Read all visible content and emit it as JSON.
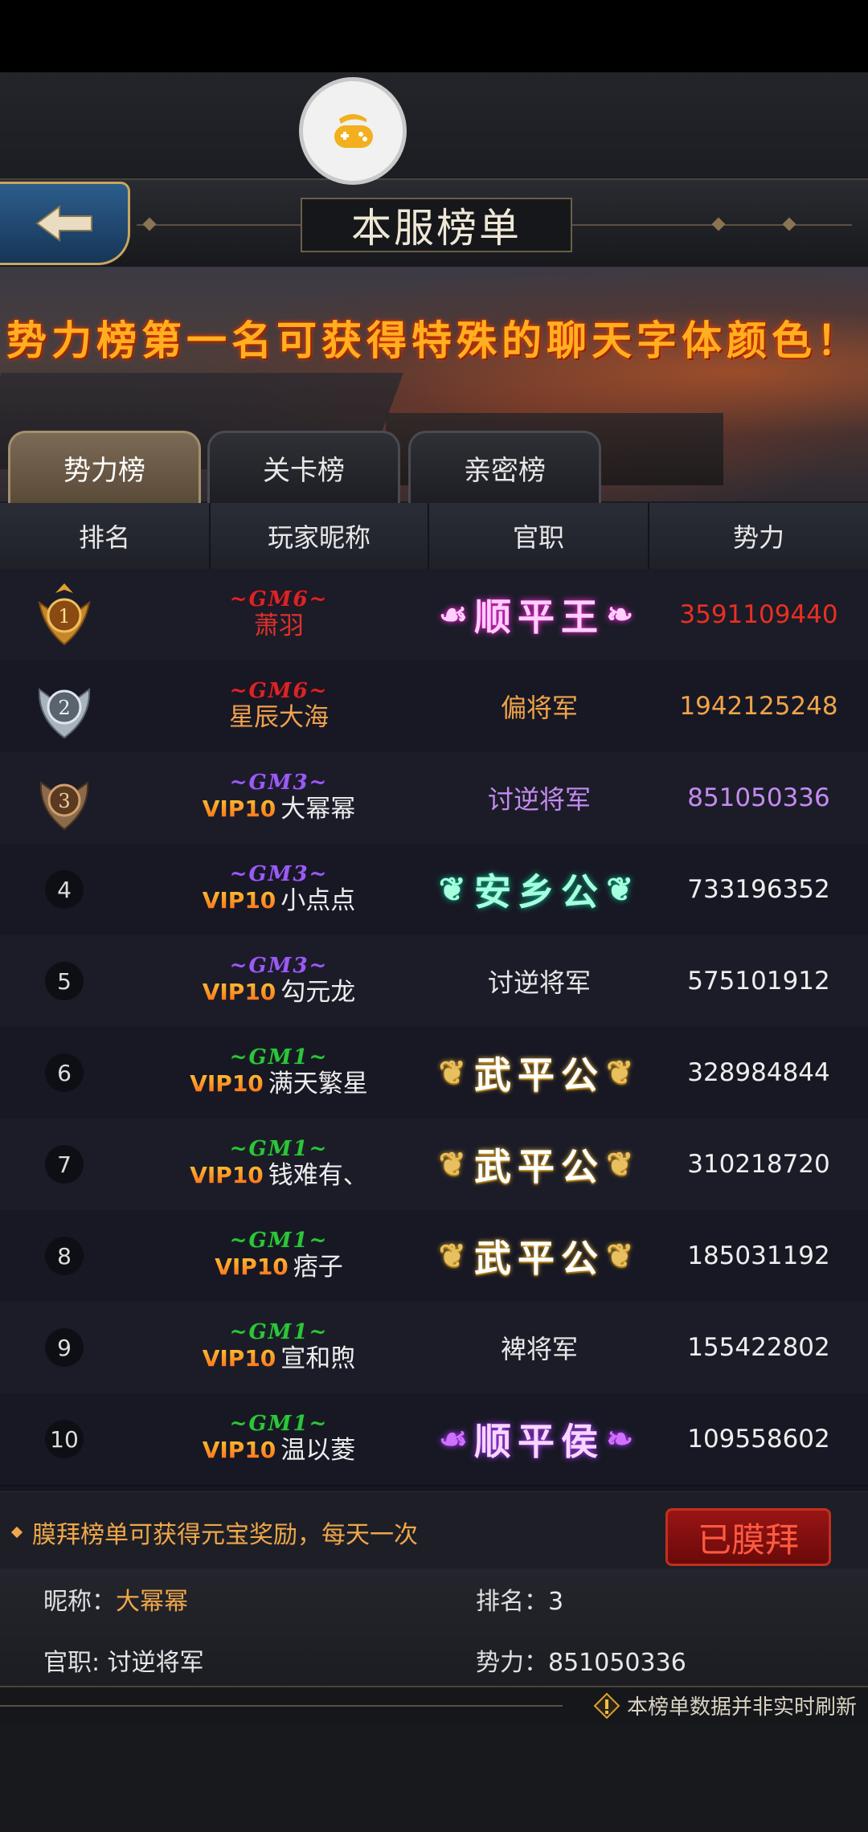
{
  "header": {
    "title": "本服榜单"
  },
  "banner": {
    "text": "势力榜第一名可获得特殊的聊天字体颜色！"
  },
  "tabs": [
    {
      "label": "势力榜",
      "active": true
    },
    {
      "label": "关卡榜",
      "active": false
    },
    {
      "label": "亲密榜",
      "active": false
    }
  ],
  "table": {
    "headers": [
      "排名",
      "玩家昵称",
      "官职",
      "势力"
    ],
    "rows": [
      {
        "rank": "1",
        "gm": "~GM6~",
        "vip": "",
        "name": "萧羽",
        "title": "顺平王",
        "power": "3591109440"
      },
      {
        "rank": "2",
        "gm": "~GM6~",
        "vip": "",
        "name": "星辰大海",
        "title": "偏将军",
        "power": "1942125248"
      },
      {
        "rank": "3",
        "gm": "~GM3~",
        "vip": "VIP10",
        "name": "大幂幂",
        "title": "讨逆将军",
        "power": "851050336"
      },
      {
        "rank": "4",
        "gm": "~GM3~",
        "vip": "VIP10",
        "name": "小点点",
        "title": "安乡公",
        "power": "733196352"
      },
      {
        "rank": "5",
        "gm": "~GM3~",
        "vip": "VIP10",
        "name": "勾元龙",
        "title": "讨逆将军",
        "power": "575101912"
      },
      {
        "rank": "6",
        "gm": "~GM1~",
        "vip": "VIP10",
        "name": "满天繁星",
        "title": "武平公",
        "power": "328984844"
      },
      {
        "rank": "7",
        "gm": "~GM1~",
        "vip": "VIP10",
        "name": "钱难有、",
        "title": "武平公",
        "power": "310218720"
      },
      {
        "rank": "8",
        "gm": "~GM1~",
        "vip": "VIP10",
        "name": "痞子",
        "title": "武平公",
        "power": "185031192"
      },
      {
        "rank": "9",
        "gm": "~GM1~",
        "vip": "VIP10",
        "name": "宣和煦",
        "title": "裨将军",
        "power": "155422802"
      },
      {
        "rank": "10",
        "gm": "~GM1~",
        "vip": "VIP10",
        "name": "温以菱",
        "title": "顺平侯",
        "power": "109558602"
      }
    ]
  },
  "footer": {
    "notice": "膜拜榜单可获得元宝奖励，每天一次",
    "worship_button": "已膜拜"
  },
  "my_info": {
    "nickname_label": "昵称：",
    "nickname": "大幂幂",
    "rank_label": "排名：",
    "rank": "3",
    "title_label": "官职:",
    "title": "讨逆将军",
    "power_label": "势力：",
    "power": "851050336"
  },
  "refresh_note": "本榜单数据并非实时刷新",
  "colors": {
    "accent_orange": "#f0a74a",
    "rank1_red": "#ea2f22",
    "button_red": "#9a1414"
  }
}
